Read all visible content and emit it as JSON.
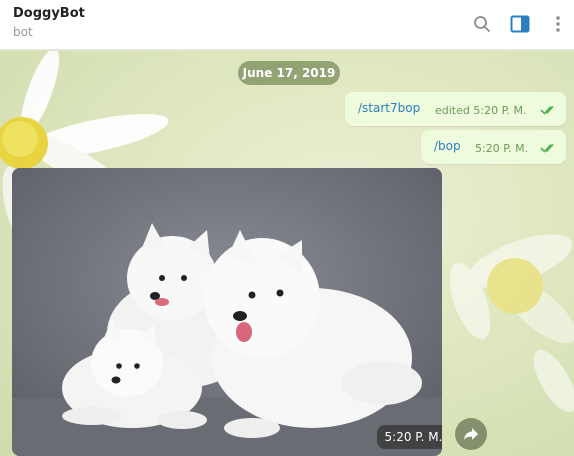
{
  "header": {
    "title": "DoggyBot",
    "subtitle": "bot"
  },
  "chat": {
    "date": "June 17, 2019",
    "messages": [
      {
        "text": "/start7bop",
        "meta": "edited 5:20 P. M."
      },
      {
        "text": "/bop",
        "meta": "5:20 P. M."
      }
    ],
    "photo_time": "5:20 P. M."
  },
  "icons": [
    "search-icon",
    "sidebar-panel-icon",
    "more-icon",
    "double-check-icon",
    "forward-icon"
  ],
  "colors": {
    "accent": "#2a7fc0",
    "bubble": "#eefbdd",
    "check": "#4fae4e"
  }
}
